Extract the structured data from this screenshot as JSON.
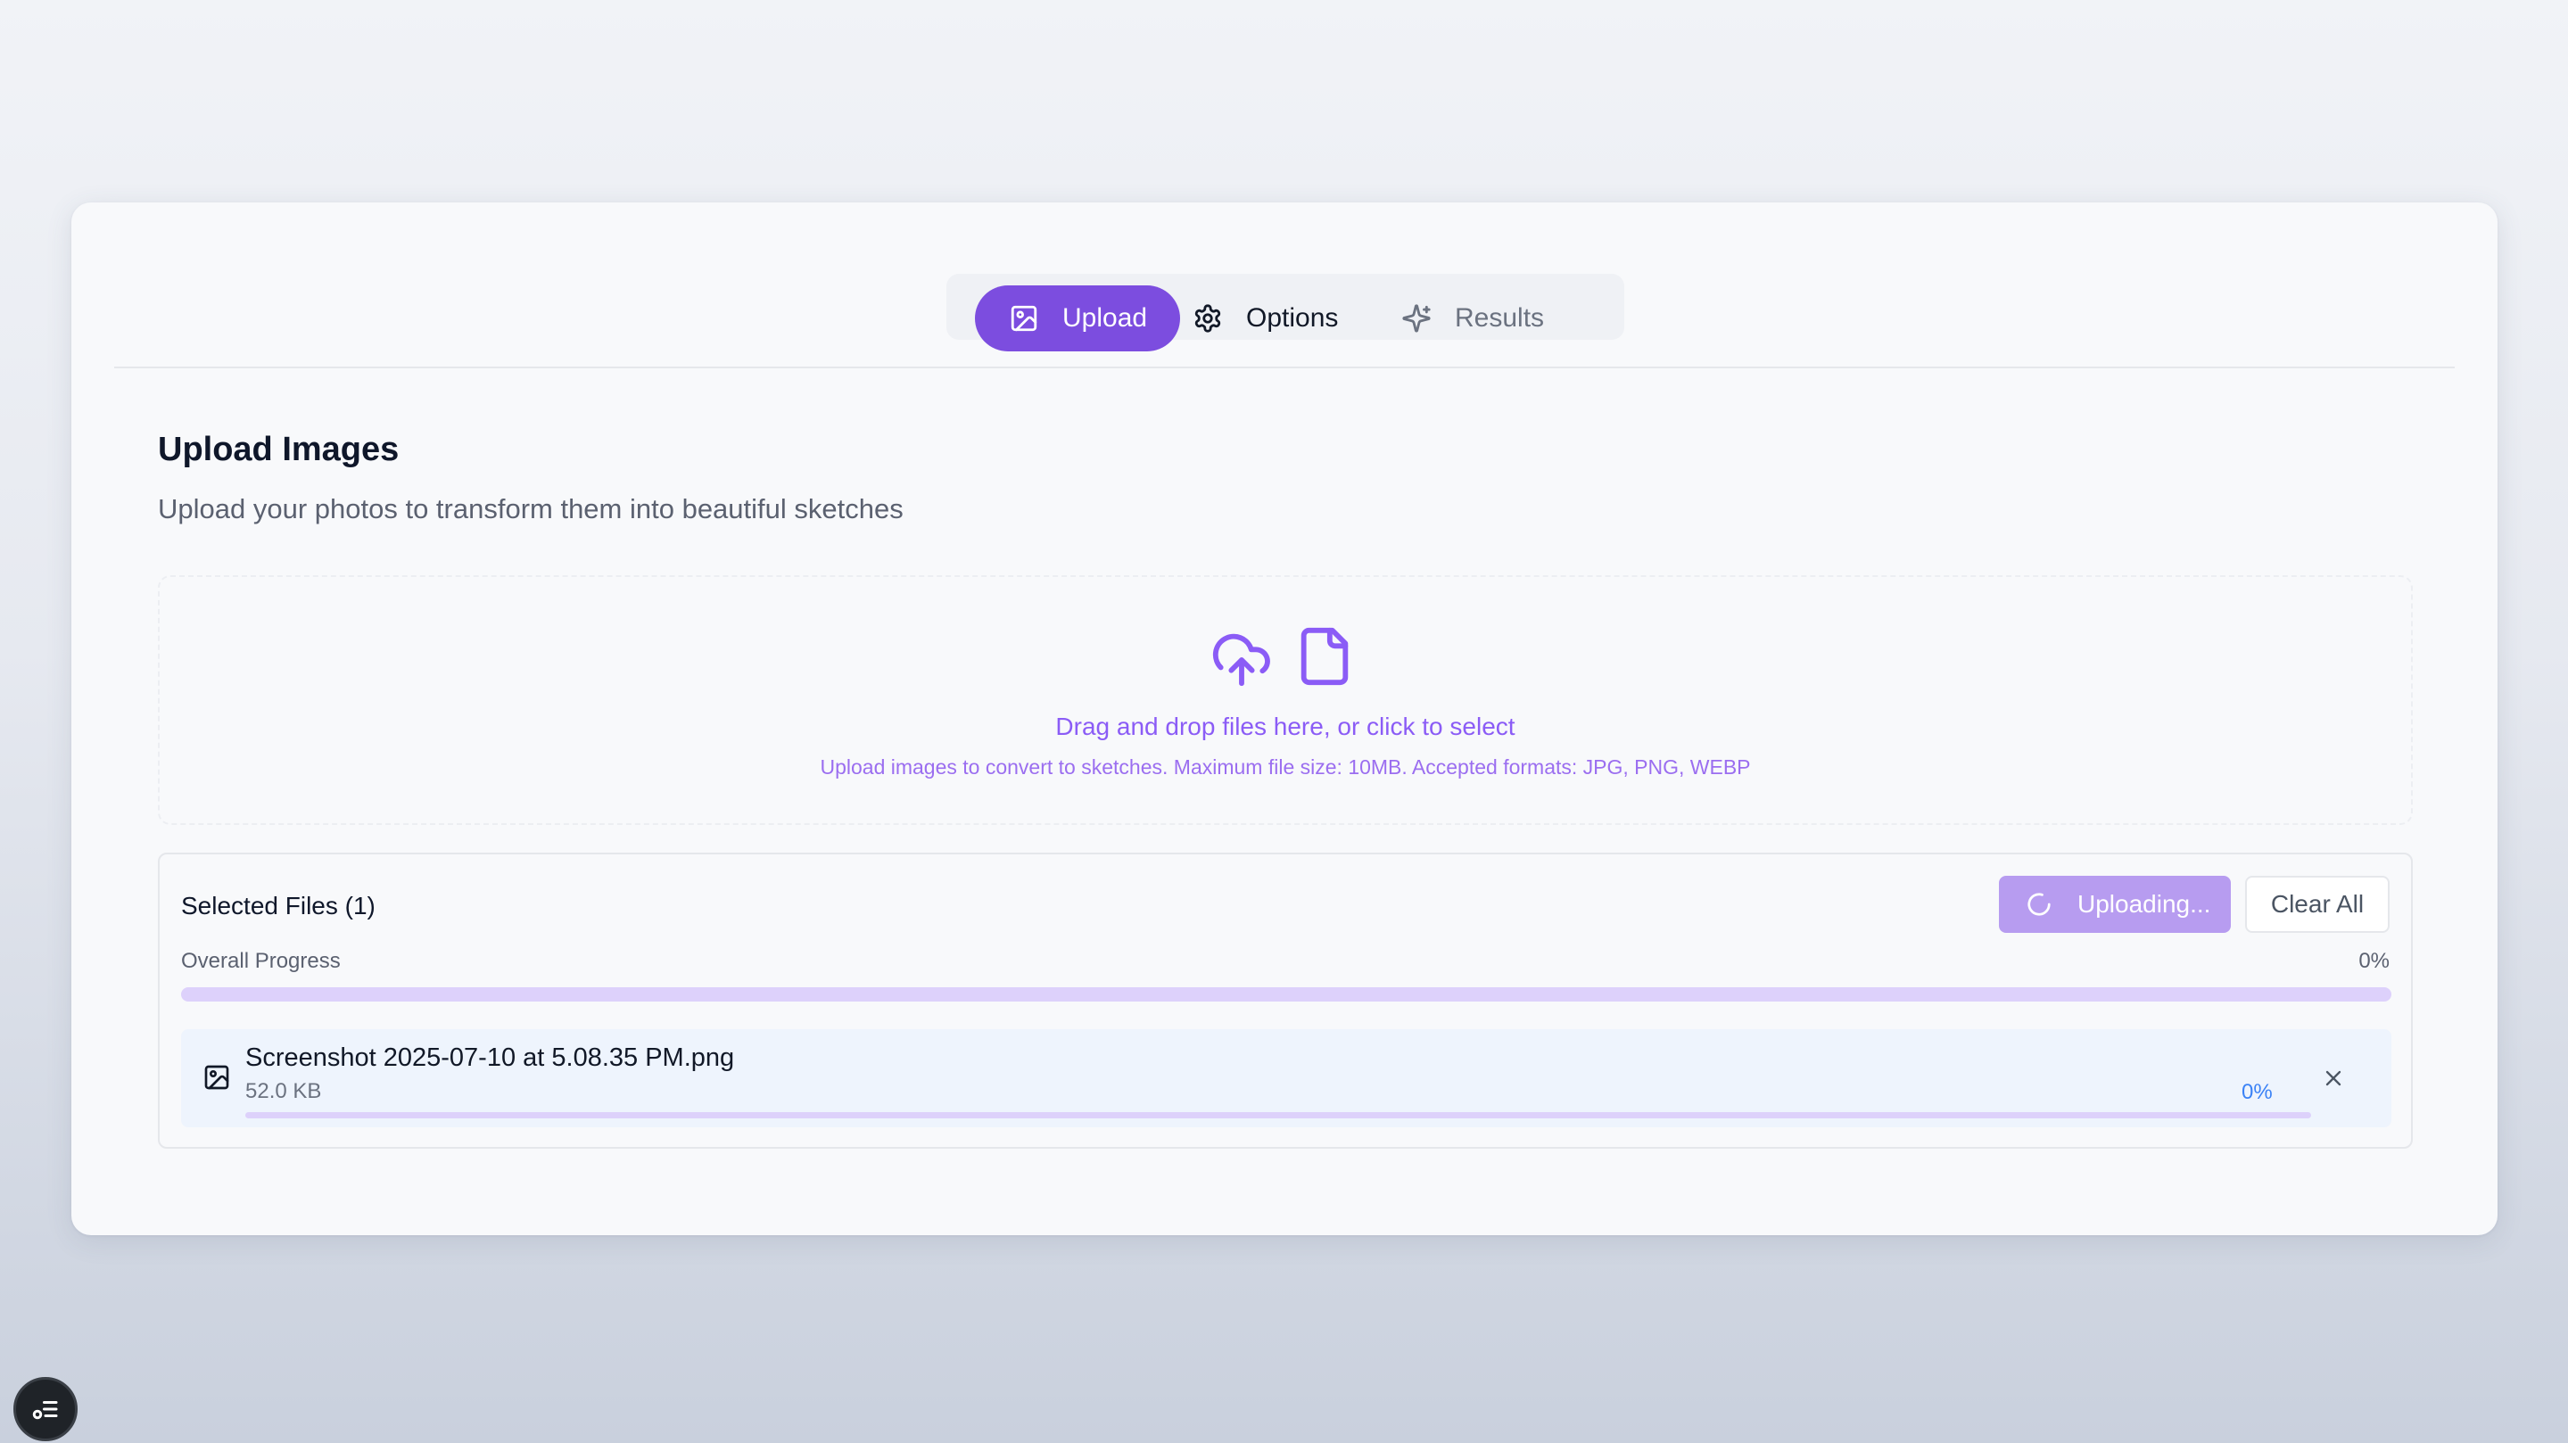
{
  "tabs": [
    {
      "label": "Upload",
      "icon": "image-icon",
      "active": true
    },
    {
      "label": "Options",
      "icon": "gear-icon",
      "active": false
    },
    {
      "label": "Results",
      "icon": "sparkles-icon",
      "active": false
    }
  ],
  "main": {
    "title": "Upload Images",
    "subtitle": "Upload your photos to transform them into beautiful sketches"
  },
  "dropzone": {
    "primary_text": "Drag and drop files here, or click to select",
    "secondary_text": "Upload images to convert to sketches. Maximum file size: 10MB. Accepted formats: JPG, PNG, WEBP",
    "icons": [
      "cloud-upload-icon",
      "file-icon"
    ]
  },
  "files_panel": {
    "title": "Selected Files (1)",
    "uploading_label": "Uploading...",
    "clear_label": "Clear All",
    "overall_label": "Overall Progress",
    "overall_percent": "0%",
    "overall_progress": 0,
    "files": [
      {
        "name": "Screenshot 2025-07-10 at 5.08.35 PM.png",
        "size": "52.0 KB",
        "percent": "0%",
        "progress": 0
      }
    ]
  },
  "colors": {
    "accent": "#7c4ddf",
    "accent_light": "#b79cf0",
    "progress_track": "#ddd1fb",
    "file_row_bg": "#eef4fd",
    "percent_blue": "#3b82f6"
  }
}
